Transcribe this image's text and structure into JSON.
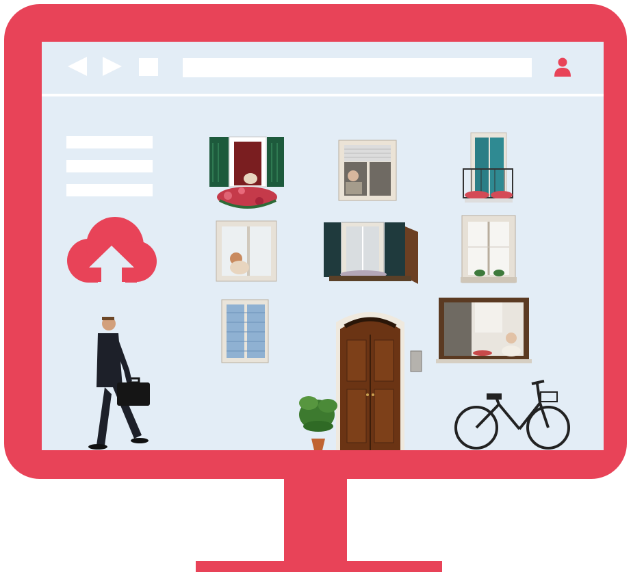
{
  "colors": {
    "frame": "#e84358",
    "screen": "#e3edf6",
    "bar": "#ffffff"
  },
  "browser": {
    "icons": [
      "back-arrow-icon",
      "forward-arrow-icon",
      "stop-icon",
      "user-icon"
    ],
    "address_bar_value": ""
  },
  "sidebar": {
    "menu_icon": "hamburger-menu-icon",
    "upload_icon": "cloud-upload-icon"
  },
  "illustration": {
    "elements": [
      "window-green-shutters-cat",
      "window-woman-looking-out",
      "window-blue-shutters-balcony",
      "window-woman-with-dog",
      "window-dark-shutters-flowers",
      "window-lace-curtains",
      "window-blue-blinds",
      "wooden-front-door",
      "intercom-panel",
      "window-elderly-woman",
      "businessman-with-briefcase",
      "potted-plant",
      "bicycle-with-basket"
    ]
  }
}
